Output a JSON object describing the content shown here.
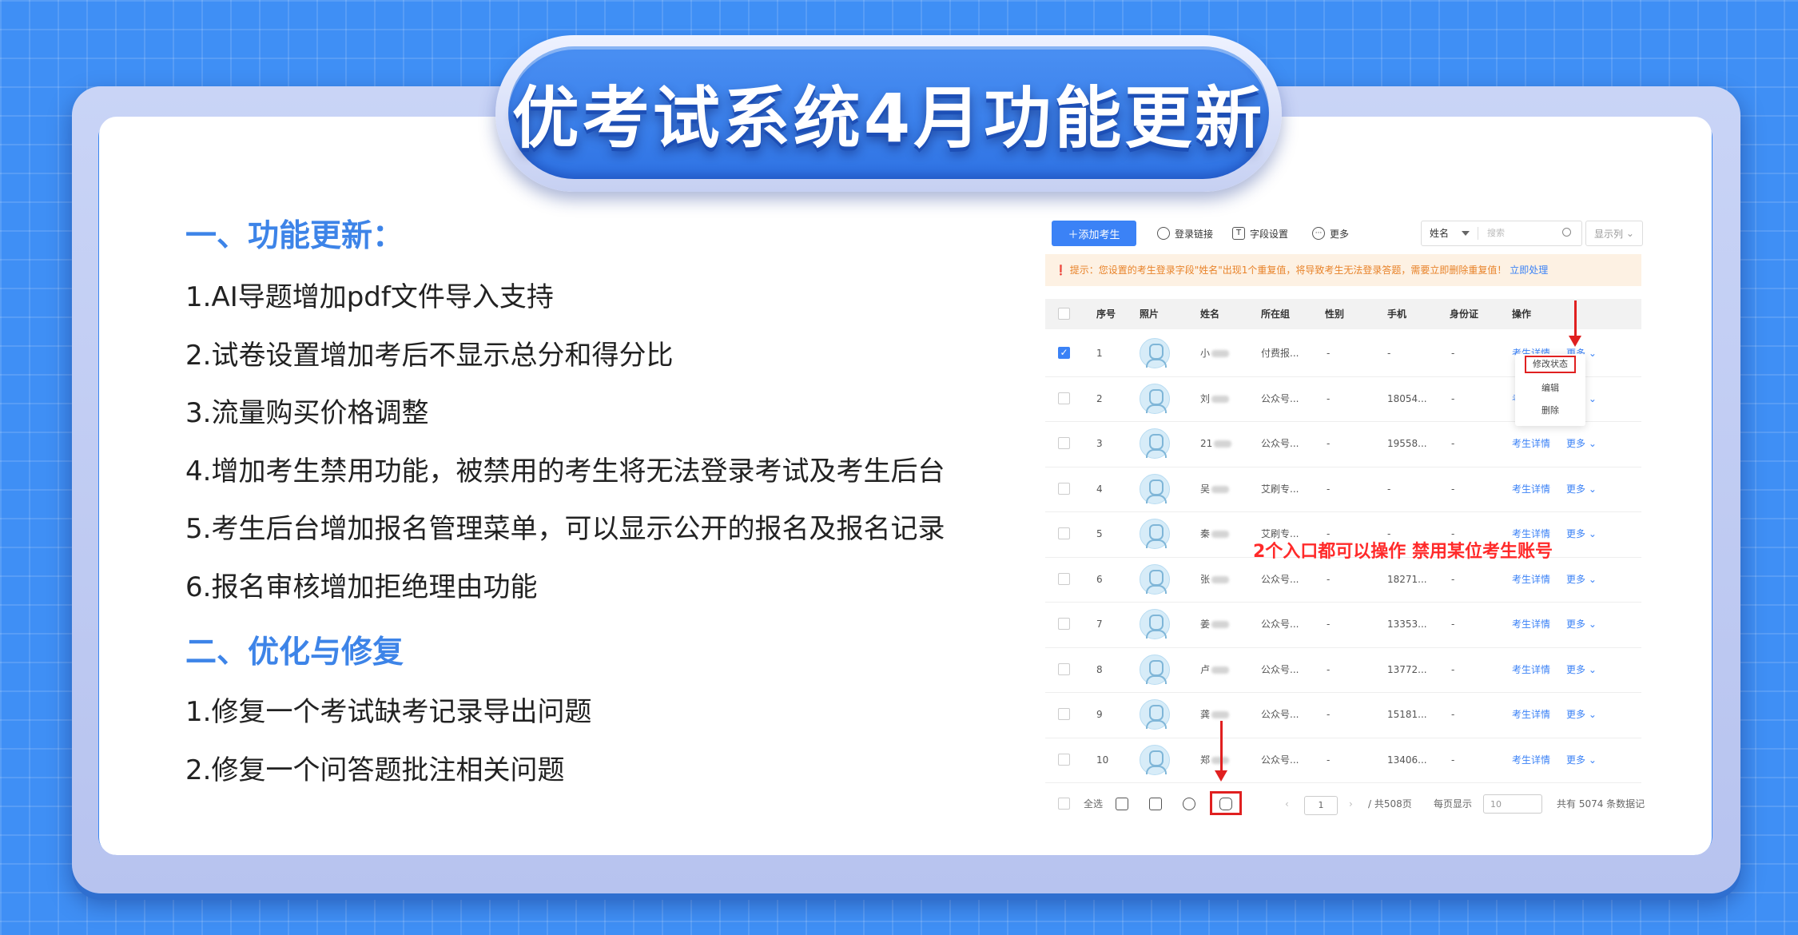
{
  "title": "优考试系统4月功能更新",
  "left": {
    "section1_title": "一、功能更新：",
    "updates": [
      "1.AI导题增加pdf文件导入支持",
      "2.试卷设置增加考后不显示总分和得分比",
      "3.流量购买价格调整",
      "4.增加考生禁用功能，被禁用的考生将无法登录考试及考生后台",
      "5.考生后台增加报名管理菜单，可以显示公开的报名及报名记录",
      "6.报名审核增加拒绝理由功能"
    ],
    "section2_title": "二、优化与修复",
    "fixes": [
      "1.修复一个考试缺考记录导出问题",
      "2.修复一个问答题批注相关问题"
    ]
  },
  "screenshot": {
    "toolbar": {
      "add_button": "＋添加考生",
      "login_link": "登录链接",
      "field_settings": "字段设置",
      "more": "更多",
      "search_field": "姓名",
      "search_placeholder": "搜索",
      "columns_button": "显示列"
    },
    "tip": {
      "text": "❗ 提示：您设置的考生登录字段\"姓名\"出现1个重复值，将导致考生无法登录答题，需要立即删除重复值！",
      "link": "立即处理"
    },
    "columns": [
      "序号",
      "照片",
      "姓名",
      "所在组",
      "性别",
      "手机",
      "身份证",
      "操作"
    ],
    "rows": [
      {
        "no": "1",
        "name": "小",
        "group": "付费报...",
        "gender": "-",
        "phone": "-",
        "id": "-",
        "checked": true
      },
      {
        "no": "2",
        "name": "刘",
        "group": "公众号...",
        "gender": "-",
        "phone": "18054...",
        "id": "-",
        "checked": false
      },
      {
        "no": "3",
        "name": "21",
        "group": "公众号...",
        "gender": "-",
        "phone": "19558...",
        "id": "-",
        "checked": false
      },
      {
        "no": "4",
        "name": "吴",
        "group": "艾刷专...",
        "gender": "-",
        "phone": "-",
        "id": "-",
        "checked": false
      },
      {
        "no": "5",
        "name": "秦",
        "group": "艾刷专...",
        "gender": "-",
        "phone": "-",
        "id": "-",
        "checked": false
      },
      {
        "no": "6",
        "name": "张",
        "group": "公众号...",
        "gender": "-",
        "phone": "18271...",
        "id": "-",
        "checked": false
      },
      {
        "no": "7",
        "name": "姜",
        "group": "公众号...",
        "gender": "-",
        "phone": "13353...",
        "id": "-",
        "checked": false
      },
      {
        "no": "8",
        "name": "卢",
        "group": "公众号...",
        "gender": "-",
        "phone": "13772...",
        "id": "-",
        "checked": false
      },
      {
        "no": "9",
        "name": "龚",
        "group": "公众号...",
        "gender": "-",
        "phone": "15181...",
        "id": "-",
        "checked": false
      },
      {
        "no": "10",
        "name": "郑",
        "group": "公众号...",
        "gender": "-",
        "phone": "13406...",
        "id": "-",
        "checked": false
      }
    ],
    "row_action_detail": "考生详情",
    "row_action_more": "更多",
    "dropdown_items": [
      "修改状态",
      "编辑",
      "删除"
    ],
    "annotation": "2个入口都可以操作 禁用某位考生账号",
    "footer": {
      "select_all": "全选",
      "page_value": "1",
      "total_pages": "/ 共508页",
      "per_page_label": "每页显示",
      "per_page_value": "10",
      "total_records": "共有 5074 条数据记"
    },
    "colors": {
      "accent": "#3b82f6",
      "highlight": "#e02020",
      "tip_bg": "#fdf1e3",
      "tip_text": "#e8832a"
    }
  }
}
